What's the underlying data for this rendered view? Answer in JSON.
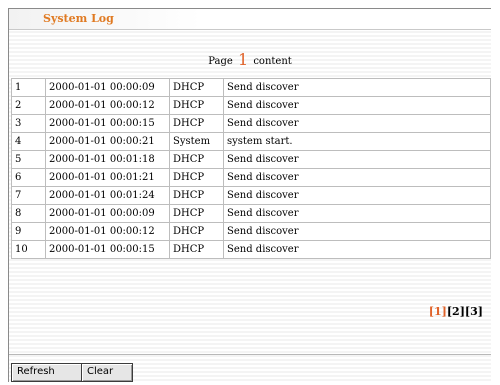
{
  "title": "System Log",
  "page_line": {
    "prefix": "Page",
    "current": "1",
    "suffix": "content"
  },
  "log": {
    "rows": [
      {
        "idx": "1",
        "time": "2000-01-01 00:00:09",
        "type": "DHCP",
        "message": "Send discover"
      },
      {
        "idx": "2",
        "time": "2000-01-01 00:00:12",
        "type": "DHCP",
        "message": "Send discover"
      },
      {
        "idx": "3",
        "time": "2000-01-01 00:00:15",
        "type": "DHCP",
        "message": "Send discover"
      },
      {
        "idx": "4",
        "time": "2000-01-01 00:00:21",
        "type": "System",
        "message": "system start."
      },
      {
        "idx": "5",
        "time": "2000-01-01 00:01:18",
        "type": "DHCP",
        "message": "Send discover"
      },
      {
        "idx": "6",
        "time": "2000-01-01 00:01:21",
        "type": "DHCP",
        "message": "Send discover"
      },
      {
        "idx": "7",
        "time": "2000-01-01 00:01:24",
        "type": "DHCP",
        "message": "Send discover"
      },
      {
        "idx": "8",
        "time": "2000-01-01 00:00:09",
        "type": "DHCP",
        "message": "Send discover"
      },
      {
        "idx": "9",
        "time": "2000-01-01 00:00:12",
        "type": "DHCP",
        "message": "Send discover"
      },
      {
        "idx": "10",
        "time": "2000-01-01 00:00:15",
        "type": "DHCP",
        "message": "Send discover"
      }
    ]
  },
  "pager": {
    "pages": [
      "[1]",
      "[2]",
      "[3]"
    ],
    "active_index": 0
  },
  "buttons": {
    "refresh": "Refresh",
    "clear": "Clear"
  },
  "colors": {
    "accent": "#e0632a",
    "title": "#e07a22"
  }
}
